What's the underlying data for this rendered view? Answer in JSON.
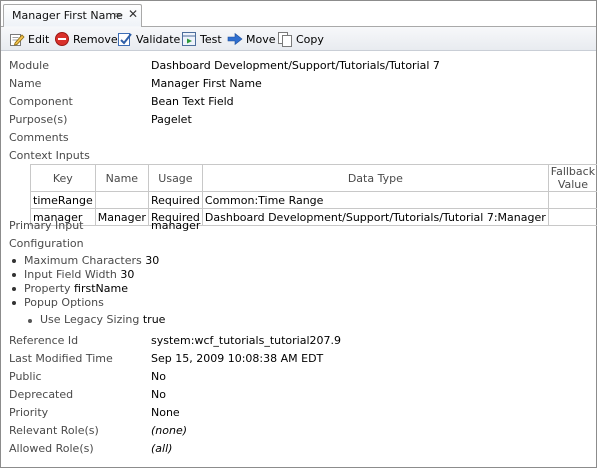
{
  "tab": {
    "title": "Manager First Name",
    "pin_icon": "pin-icon",
    "close_icon": "close-icon"
  },
  "toolbar": {
    "edit": "Edit",
    "remove": "Remove",
    "validate": "Validate",
    "test": "Test",
    "move": "Move",
    "copy": "Copy"
  },
  "props": {
    "module_label": "Module",
    "module_value": "Dashboard Development/Support/Tutorials/Tutorial 7",
    "name_label": "Name",
    "name_value": "Manager First Name",
    "component_label": "Component",
    "component_value": "Bean Text Field",
    "purpose_label": "Purpose(s)",
    "purpose_value": "Pagelet",
    "comments_label": "Comments",
    "context_inputs_label": "Context Inputs"
  },
  "context_table": {
    "headers": [
      "Key",
      "Name",
      "Usage",
      "Data Type",
      "Fallback Value"
    ],
    "rows": [
      [
        "timeRange",
        "",
        "Required",
        "Common:Time Range",
        ""
      ],
      [
        "manager",
        "Manager",
        "Required",
        "Dashboard Development/Support/Tutorials/Tutorial 7:Manager",
        ""
      ]
    ]
  },
  "primary_input": {
    "label": "Primary Input",
    "value": "manager"
  },
  "configuration": {
    "label": "Configuration",
    "items": [
      {
        "name": "Maximum Characters",
        "value": "30"
      },
      {
        "name": "Input Field Width",
        "value": "30"
      },
      {
        "name": "Property",
        "value": "firstName"
      },
      {
        "name": "Popup Options",
        "value": ""
      }
    ],
    "sub_items": [
      {
        "name": "Use Legacy Sizing",
        "value": "true"
      }
    ]
  },
  "meta": {
    "reference_id_label": "Reference Id",
    "reference_id_value": "system:wcf_tutorials_tutorial207.9",
    "last_modified_label": "Last Modified Time",
    "last_modified_value": "Sep 15, 2009 10:08:38 AM EDT",
    "public_label": "Public",
    "public_value": "No",
    "deprecated_label": "Deprecated",
    "deprecated_value": "No",
    "priority_label": "Priority",
    "priority_value": "None",
    "relevant_roles_label": "Relevant Role(s)",
    "relevant_roles_value": "(none)",
    "allowed_roles_label": "Allowed Role(s)",
    "allowed_roles_value": "(all)"
  },
  "colors": {
    "label_text": "#4a4a4a",
    "remove_red": "#d9302a",
    "move_blue": "#2f6fd0"
  }
}
